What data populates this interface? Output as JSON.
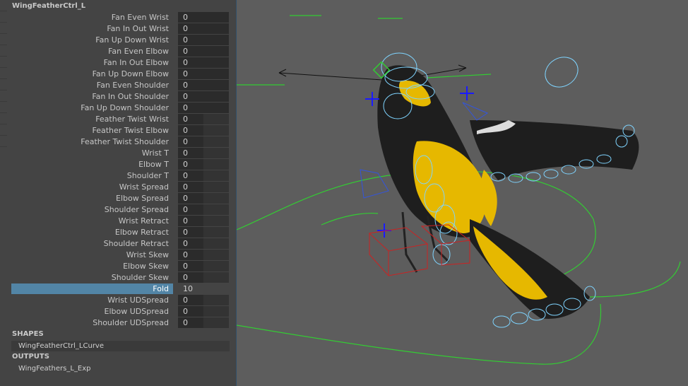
{
  "node": {
    "name": "WingFeatherCtrl_L"
  },
  "attributes": [
    {
      "label": "Fan Even Wrist",
      "value": "0"
    },
    {
      "label": "Fan In Out Wrist",
      "value": "0"
    },
    {
      "label": "Fan Up Down Wrist",
      "value": "0"
    },
    {
      "label": "Fan Even Elbow",
      "value": "0"
    },
    {
      "label": "Fan In Out Elbow",
      "value": "0"
    },
    {
      "label": "Fan Up Down Elbow",
      "value": "0"
    },
    {
      "label": "Fan Even Shoulder",
      "value": "0"
    },
    {
      "label": "Fan In Out Shoulder",
      "value": "0"
    },
    {
      "label": "Fan Up Down Shoulder",
      "value": "0"
    },
    {
      "label": "Feather Twist Wrist",
      "value": "0"
    },
    {
      "label": "Feather Twist Elbow",
      "value": "0"
    },
    {
      "label": "Feather Twist Shoulder",
      "value": "0"
    },
    {
      "label": "Wrist T",
      "value": "0"
    },
    {
      "label": "Elbow T",
      "value": "0"
    },
    {
      "label": "Shoulder T",
      "value": "0"
    },
    {
      "label": "Wrist Spread",
      "value": "0"
    },
    {
      "label": "Elbow Spread",
      "value": "0"
    },
    {
      "label": "Shoulder Spread",
      "value": "0"
    },
    {
      "label": "Wrist Retract",
      "value": "0"
    },
    {
      "label": "Elbow Retract",
      "value": "0"
    },
    {
      "label": "Shoulder Retract",
      "value": "0"
    },
    {
      "label": "Wrist Skew",
      "value": "0"
    },
    {
      "label": "Elbow Skew",
      "value": "0"
    },
    {
      "label": "Shoulder Skew",
      "value": "0"
    },
    {
      "label": "Fold",
      "value": "10",
      "selected": true
    },
    {
      "label": "Wrist UDSpread",
      "value": "0"
    },
    {
      "label": "Elbow UDSpread",
      "value": "0"
    },
    {
      "label": "Shoulder UDSpread",
      "value": "0"
    }
  ],
  "shapes": {
    "header": "SHAPES",
    "item": "WingFeatherCtrl_LCurve"
  },
  "outputs": {
    "header": "OUTPUTS",
    "item": "WingFeathers_L_Exp"
  },
  "colors": {
    "panel_bg": "#444444",
    "viewport_bg": "#5d5d5d",
    "selected_row": "#5285a6",
    "control_curve": "#7fd4ff",
    "guide_curve": "#33cc33",
    "locator": "#1a1aff",
    "foot_box": "#cc2222",
    "bird_yellow": "#e6b800",
    "bird_black": "#1e1e1e"
  }
}
